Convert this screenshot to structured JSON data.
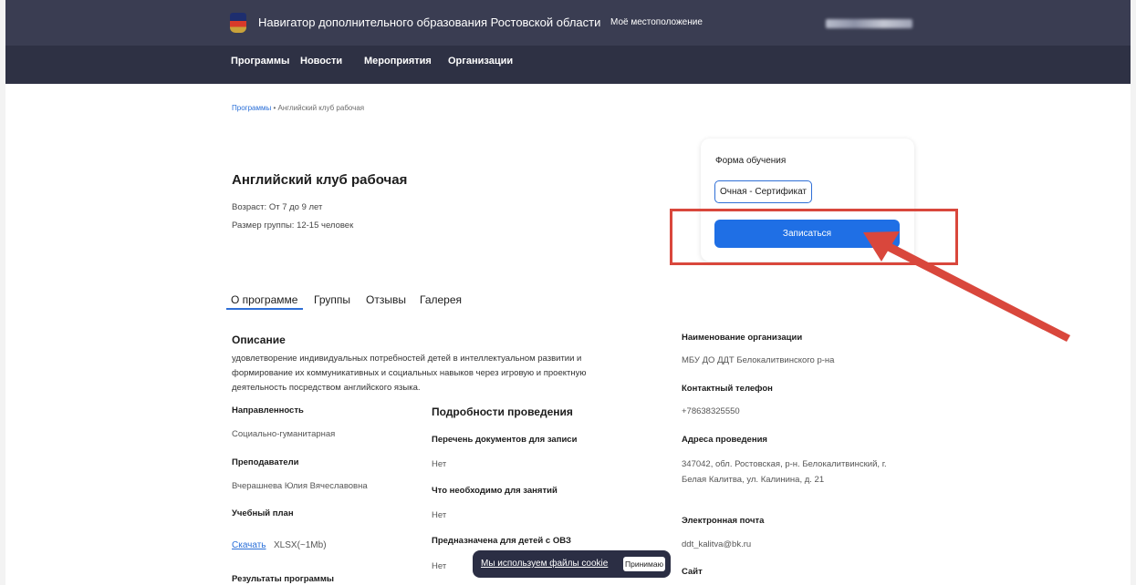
{
  "header": {
    "site_title": "Навигатор дополнительного образования Ростовской области",
    "location_label": "Моё местоположение",
    "nav": [
      "Программы",
      "Новости",
      "Мероприятия",
      "Организации"
    ]
  },
  "breadcrumb": {
    "link": "Программы",
    "separator": "•",
    "current": "Английский клуб рабочая"
  },
  "program": {
    "title": "Английский клуб рабочая",
    "age": "Возраст: От 7 до 9 лет",
    "group_size": "Размер группы: 12-15 человек"
  },
  "enroll_card": {
    "label": "Форма обучения",
    "option": "Очная - Сертификат",
    "button": "Записаться"
  },
  "tabs": [
    "О программе",
    "Группы",
    "Отзывы",
    "Галерея"
  ],
  "about": {
    "description_heading": "Описание",
    "description": "удовлетворение индивидуальных потребностей детей в интеллектуальном развитии и формирование их коммуникативных и социальных навыков через игровую и проектную деятельность посредством английского языка.",
    "direction_label": "Направленность",
    "direction_value": "Социально-гуманитарная",
    "teachers_label": "Преподаватели",
    "teachers_value": "Вчерашнева Юлия Вячеславовна",
    "curriculum_label": "Учебный план",
    "download_link": "Скачать",
    "download_meta": "XLSX(~1Mb)",
    "results_label": "Результаты программы"
  },
  "details": {
    "heading": "Подробности проведения",
    "documents_label": "Перечень документов для записи",
    "documents_value": "Нет",
    "needed_label": "Что необходимо для занятий",
    "needed_value": "Нет",
    "ovz_label": "Предназначена для детей с ОВЗ",
    "ovz_value": "Нет"
  },
  "organization": {
    "name_label": "Наименование организации",
    "name_value": "МБУ ДО ДДТ Белокалитвинского р-на",
    "phone_label": "Контактный телефон",
    "phone_value": "+78638325550",
    "address_label": "Адреса проведения",
    "address_value": "347042, обл. Ростовская, р-н. Белокалитвинский, г. Белая Калитва, ул. Калинина, д. 21",
    "email_label": "Электронная почта",
    "email_value": "ddt_kalitva@bk.ru",
    "site_label": "Сайт"
  },
  "cookie": {
    "text": "Мы используем файлы cookie",
    "button": "Принимаю"
  },
  "colors": {
    "header_bg": "#3a3d52",
    "accent": "#1f6fe5",
    "annotation": "#d9473c"
  }
}
